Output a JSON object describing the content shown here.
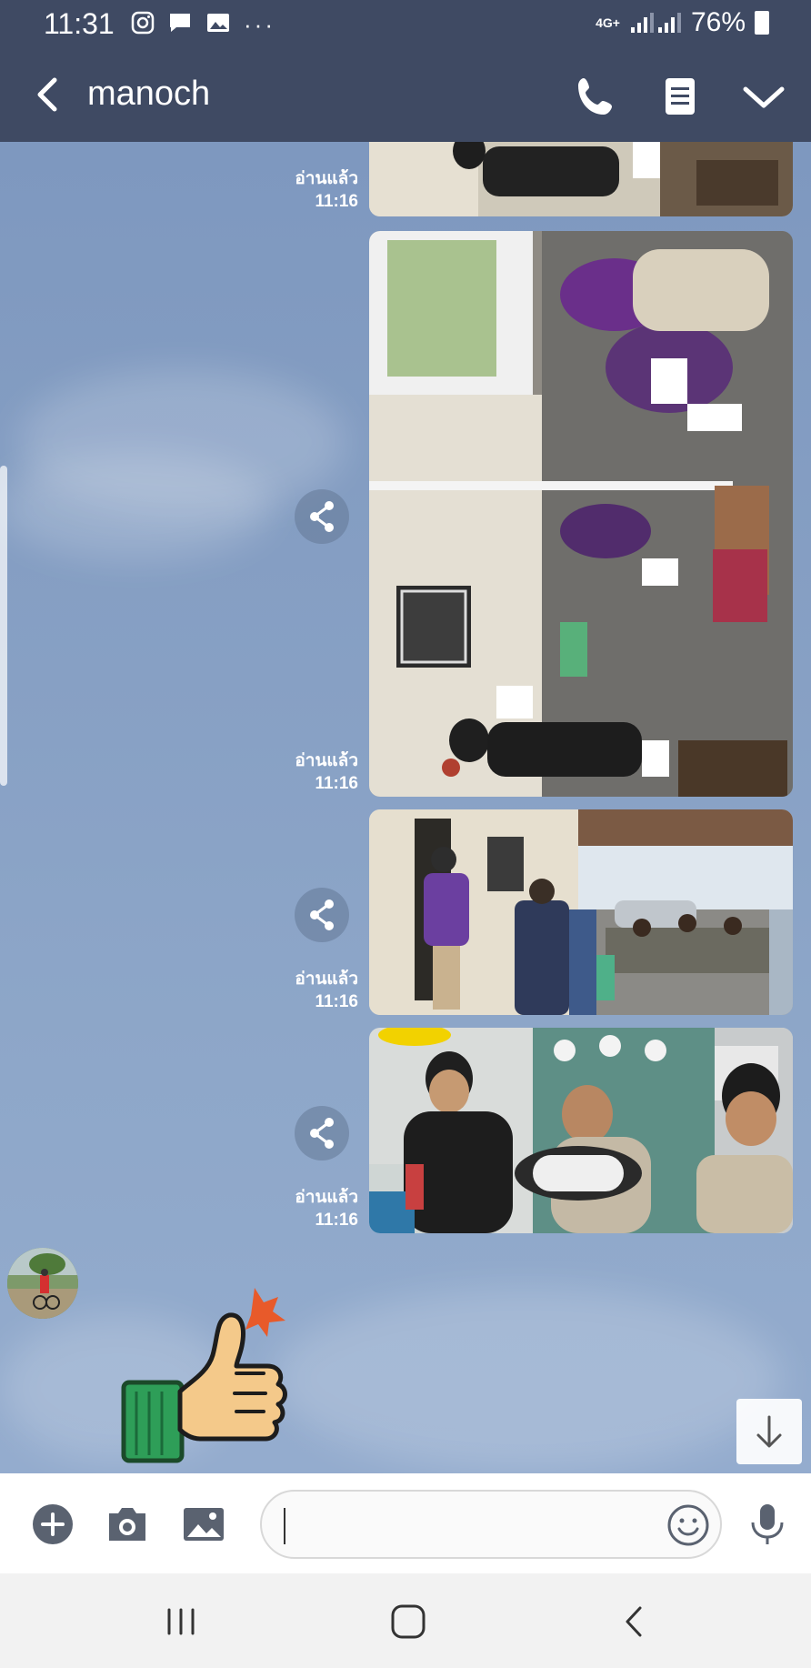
{
  "status_bar": {
    "time": "11:31",
    "network": "4G+",
    "battery": "76%"
  },
  "header": {
    "contact_name": "manoch"
  },
  "messages": [
    {
      "type": "photo",
      "read_label": "อ่านแล้ว",
      "time": "11:16"
    },
    {
      "type": "photo",
      "read_label": "อ่านแล้ว",
      "time": "11:16"
    },
    {
      "type": "photo",
      "read_label": "อ่านแล้ว",
      "time": "11:16"
    },
    {
      "type": "photo",
      "read_label": "อ่านแล้ว",
      "time": "11:16"
    }
  ],
  "incoming": {
    "sticker": "thumbs-up-sticker"
  },
  "input": {
    "text": "",
    "placeholder": ""
  },
  "colors": {
    "header_bg": "#3f4a63",
    "chat_bg": "#7f9ac0",
    "accent": "#ffffff"
  }
}
